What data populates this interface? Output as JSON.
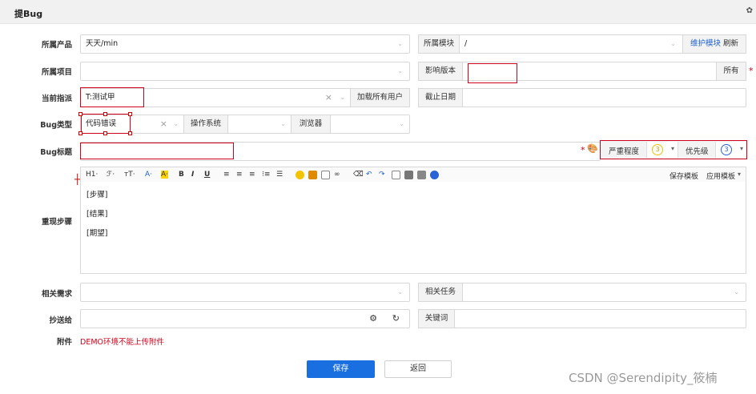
{
  "header": {
    "title": "提Bug"
  },
  "form": {
    "product": {
      "label": "所属产品",
      "value": "天天/min"
    },
    "module": {
      "label": "所属模块",
      "value": "/",
      "maintain_link": "维护模块",
      "refresh_link": "刷新"
    },
    "project": {
      "label": "所属项目",
      "value": ""
    },
    "build": {
      "label": "影响版本",
      "value": "",
      "all_button": "所有"
    },
    "assign": {
      "label": "当前指派",
      "value": "T:测试甲",
      "clear_icon": "×",
      "load_all_users": "加载所有用户"
    },
    "deadline": {
      "label": "截止日期",
      "value": ""
    },
    "type": {
      "label": "Bug类型",
      "value": "代码错误",
      "clear_icon": "×"
    },
    "os": {
      "label": "操作系统",
      "value": ""
    },
    "browser": {
      "label": "浏览器",
      "value": ""
    },
    "bug_title": {
      "label": "Bug标题",
      "value": ""
    },
    "severity": {
      "label": "严重程度",
      "value": "3"
    },
    "priority": {
      "label": "优先级",
      "value": "3"
    },
    "steps": {
      "label": "重现步骤",
      "toolbar": {
        "heading": "H1·",
        "font": "ℱ·",
        "font_size": "тT·",
        "font_color": "A·",
        "bg_color": "A·",
        "bold": "B",
        "italic": "I",
        "underline": "U",
        "save_template": "保存模板",
        "apply_template": "应用模板"
      },
      "lines": [
        "[步骤]",
        "[结果]",
        "[期望]"
      ]
    },
    "story": {
      "label": "相关需求",
      "value": ""
    },
    "task": {
      "label": "相关任务",
      "value": ""
    },
    "mailto": {
      "label": "抄送给",
      "value": ""
    },
    "keywords": {
      "label": "关键词",
      "value": ""
    },
    "files": {
      "label": "附件",
      "notice": "DEMO环境不能上传附件"
    },
    "save_button": "保存",
    "back_button": "返回"
  },
  "watermark": "CSDN @Serendipity_筱楠",
  "colors": {
    "primary": "#1a6fe0",
    "annotation_red": "#d0021b",
    "link": "#1e62d0"
  }
}
